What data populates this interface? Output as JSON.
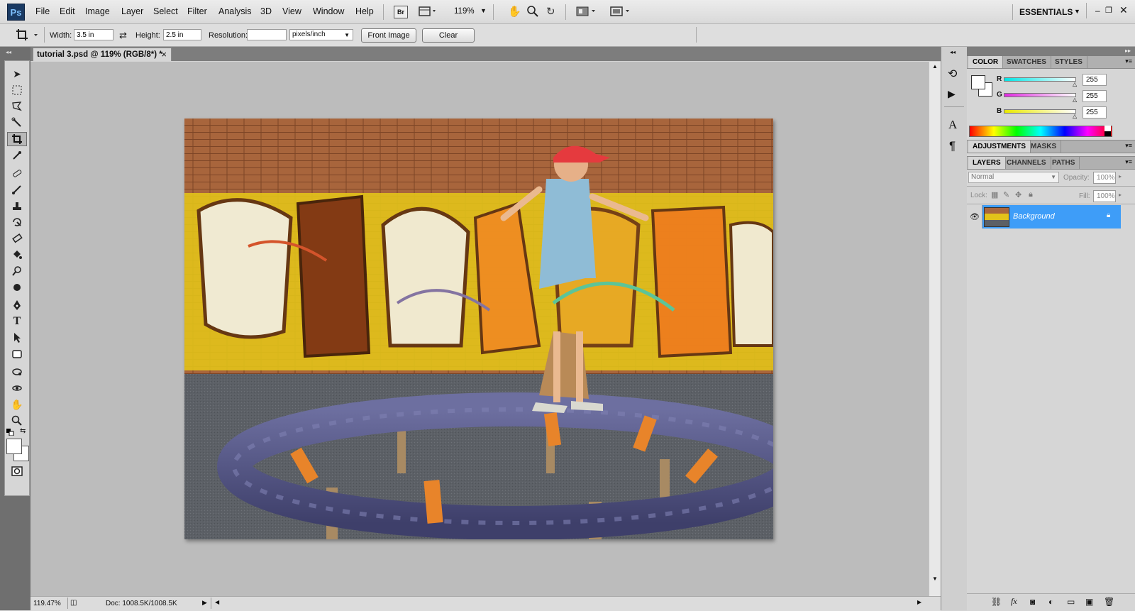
{
  "app": {
    "logo": "Ps"
  },
  "menu": [
    "File",
    "Edit",
    "Image",
    "Layer",
    "Select",
    "Filter",
    "Analysis",
    "3D",
    "View",
    "Window",
    "Help"
  ],
  "appbar": {
    "bridge": "Br",
    "zoom": "119%",
    "workspace": "ESSENTIALS"
  },
  "options": {
    "width_label": "Width:",
    "width_value": "3.5 in",
    "height_label": "Height:",
    "height_value": "2.5 in",
    "resolution_label": "Resolution:",
    "resolution_value": "",
    "units": "pixels/inch",
    "front_image": "Front Image",
    "clear": "Clear"
  },
  "document": {
    "tab_title": "tutorial 3.psd @ 119% (RGB/8*) *",
    "close": "×"
  },
  "status": {
    "zoom": "119.47%",
    "doc": "Doc: 1008.5K/1008.5K"
  },
  "color_panel": {
    "tabs": [
      "COLOR",
      "SWATCHES",
      "STYLES"
    ],
    "channels": [
      {
        "label": "R",
        "value": "255"
      },
      {
        "label": "G",
        "value": "255"
      },
      {
        "label": "B",
        "value": "255"
      }
    ]
  },
  "adjust_panel": {
    "tabs": [
      "ADJUSTMENTS",
      "MASKS"
    ]
  },
  "layers_panel": {
    "tabs": [
      "LAYERS",
      "CHANNELS",
      "PATHS"
    ],
    "blend_mode": "Normal",
    "opacity_label": "Opacity:",
    "opacity_value": "100%",
    "lock_label": "Lock:",
    "fill_label": "Fill:",
    "fill_value": "100%",
    "layers": [
      {
        "name": "Background"
      }
    ]
  },
  "colors": {
    "accent": "#3e9df8",
    "foreground": "#ffffff",
    "background": "#ffffff"
  }
}
